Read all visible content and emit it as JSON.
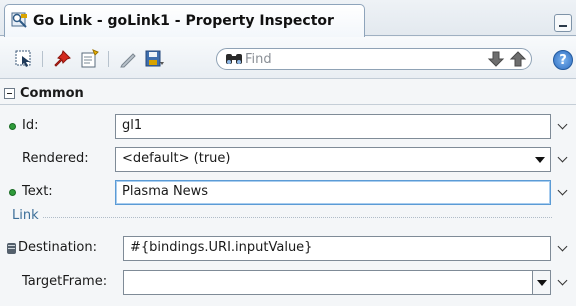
{
  "window": {
    "tab_title": "Go Link - goLink1 - Property Inspector",
    "tab_icon": "go-link-icon",
    "minimize_icon": "minimize-icon"
  },
  "toolbar": {
    "buttons": [
      {
        "icon": "select-in-editor-icon"
      },
      {
        "icon": "pin-icon"
      },
      {
        "icon": "edit-properties-icon"
      },
      {
        "icon": "pencil-icon"
      },
      {
        "icon": "save-icon"
      }
    ],
    "find_placeholder": "Find",
    "find_icon": "binoculars-icon",
    "next_icon": "arrow-down-icon",
    "previous_icon": "arrow-up-icon",
    "help_label": "?"
  },
  "sections": {
    "common": {
      "title": "Common",
      "fields": {
        "id": {
          "label": "Id:",
          "value": "gl1",
          "required": true
        },
        "rendered": {
          "label": "Rendered:",
          "value": "<default> (true)"
        },
        "text": {
          "label": "Text:",
          "value": "Plasma News",
          "required": true
        }
      }
    },
    "link": {
      "title": "Link",
      "fields": {
        "destination": {
          "label": "Destination:",
          "value": "#{bindings.URI.inputValue}",
          "bound_icon": "data-binding-icon"
        },
        "target_frame": {
          "label": "TargetFrame:",
          "value": ""
        }
      }
    }
  },
  "colors": {
    "required_marker": "#2e9b3a",
    "focus_border": "#5b9bd5",
    "group_label": "#3d6f99"
  }
}
